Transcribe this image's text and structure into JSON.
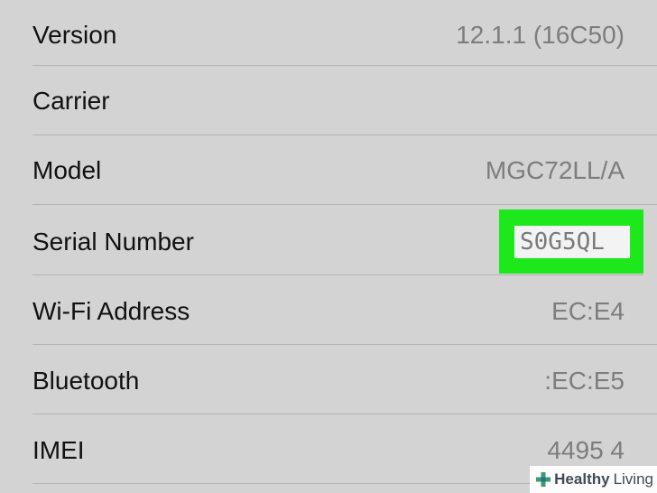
{
  "rows": [
    {
      "label": "Version",
      "value": "12.1.1 (16C50)"
    },
    {
      "label": "Carrier",
      "value": ""
    },
    {
      "label": "Model",
      "value": "MGC72LL/A"
    },
    {
      "label": "Serial Number",
      "value": "S0G5QL"
    },
    {
      "label": "Wi-Fi Address",
      "value": "EC:E4"
    },
    {
      "label": "Bluetooth",
      "value": ":EC:E5"
    },
    {
      "label": "IMEI",
      "value": "4495 4"
    }
  ],
  "highlight_color": "#1ce81c",
  "watermark": {
    "brand_bold": "Healthy",
    "brand_light": "Living",
    "icon": "plus-icon"
  }
}
